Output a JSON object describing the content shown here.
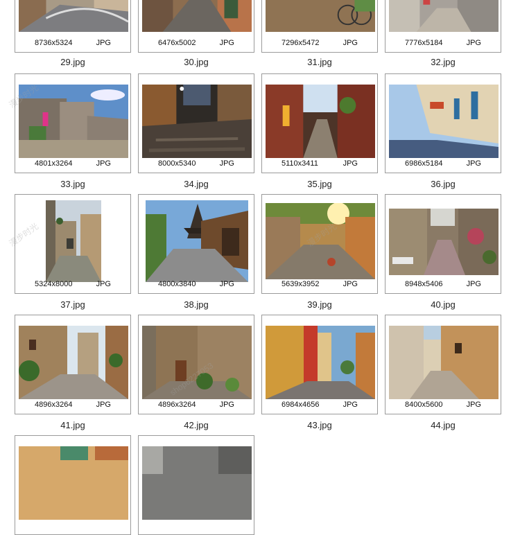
{
  "items": [
    {
      "dims": "8736x5324",
      "type": "JPG",
      "file": "29.jpg"
    },
    {
      "dims": "6476x5002",
      "type": "JPG",
      "file": "30.jpg"
    },
    {
      "dims": "7296x5472",
      "type": "JPG",
      "file": "31.jpg"
    },
    {
      "dims": "7776x5184",
      "type": "JPG",
      "file": "32.jpg"
    },
    {
      "dims": "4801x3264",
      "type": "JPG",
      "file": "33.jpg"
    },
    {
      "dims": "8000x5340",
      "type": "JPG",
      "file": "34.jpg"
    },
    {
      "dims": "5110x3411",
      "type": "JPG",
      "file": "35.jpg"
    },
    {
      "dims": "6986x5184",
      "type": "JPG",
      "file": "36.jpg"
    },
    {
      "dims": "5324x8000",
      "type": "JPG",
      "file": "37.jpg"
    },
    {
      "dims": "4800x3840",
      "type": "JPG",
      "file": "38.jpg"
    },
    {
      "dims": "5639x3952",
      "type": "JPG",
      "file": "39.jpg"
    },
    {
      "dims": "8948x5406",
      "type": "JPG",
      "file": "40.jpg"
    },
    {
      "dims": "4896x3264",
      "type": "JPG",
      "file": "41.jpg"
    },
    {
      "dims": "4896x3264",
      "type": "JPG",
      "file": "42.jpg"
    },
    {
      "dims": "6984x4656",
      "type": "JPG",
      "file": "43.jpg"
    },
    {
      "dims": "8400x5600",
      "type": "JPG",
      "file": "44.jpg"
    }
  ],
  "watermark": {
    "text": "漫步时光",
    "sub": "shop6227053"
  },
  "colors": {
    "border": "#9a9a9a",
    "text": "#222222"
  }
}
